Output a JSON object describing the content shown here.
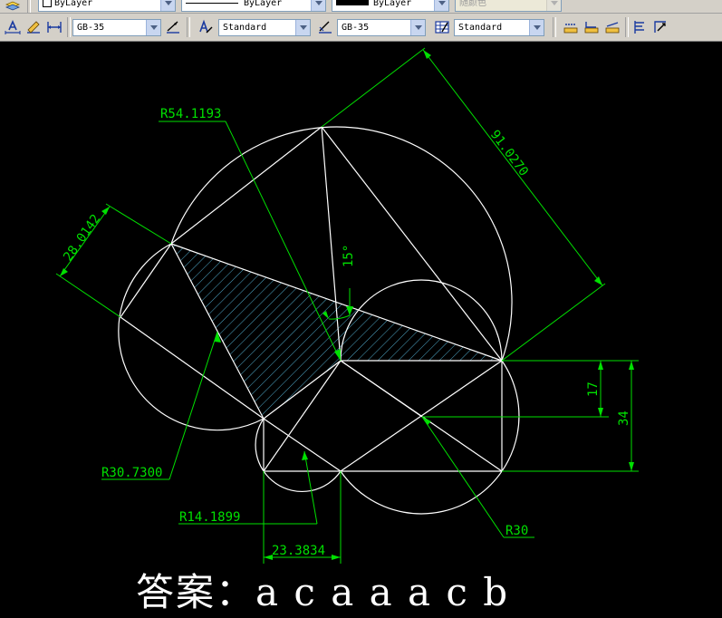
{
  "toolbar_top": {
    "layer_color_value": "ByLayer",
    "linetype_value": "ByLayer",
    "lineweight_value": "ByLayer",
    "plot_style_value": "随颜色"
  },
  "toolbar_bottom": {
    "dim_style_value": "GB-35",
    "text_style_value": "Standard",
    "dim_style_2_value": "GB-35",
    "table_style_value": "Standard"
  },
  "icons": [
    "layers-icon",
    "dimension-text-icon",
    "dimension-edit-icon",
    "dimension-linear-icon",
    "dimension-style-icon",
    "text-style-icon",
    "dimension-style-manager-icon",
    "table-style-icon",
    "multileader-icons"
  ],
  "drawing": {
    "background_color": "#000000",
    "line_color": "#ffffff",
    "dimension_color": "#00e000",
    "hatch_color": "#4fa8c8",
    "dimensions": {
      "r_large": "R54.1193",
      "aligned_91": "91.0270",
      "aligned_28": "28.0142",
      "angle_15": "15°",
      "r_30_73": "R30.7300",
      "r_14_19": "R14.1899",
      "r_30": "R30",
      "linear_23": "23.3834",
      "vertical_17": "17",
      "vertical_34": "34"
    }
  },
  "answer_text": "答案：a c a a a c b"
}
